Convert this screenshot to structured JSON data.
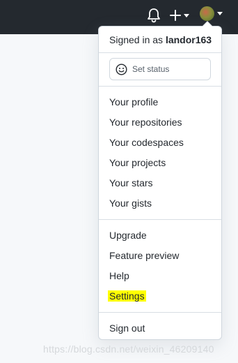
{
  "header": {
    "icons": [
      "bell-icon",
      "plus-icon",
      "avatar"
    ]
  },
  "menu": {
    "signed_in_prefix": "Signed in as ",
    "username": "landor163",
    "set_status": "Set status",
    "group1": [
      "Your profile",
      "Your repositories",
      "Your codespaces",
      "Your projects",
      "Your stars",
      "Your gists"
    ],
    "group2": [
      "Upgrade",
      "Feature preview",
      "Help",
      "Settings"
    ],
    "sign_out": "Sign out"
  },
  "highlight_color": "#ffff00",
  "watermark": "https://blog.csdn.net/weixin_46209140"
}
